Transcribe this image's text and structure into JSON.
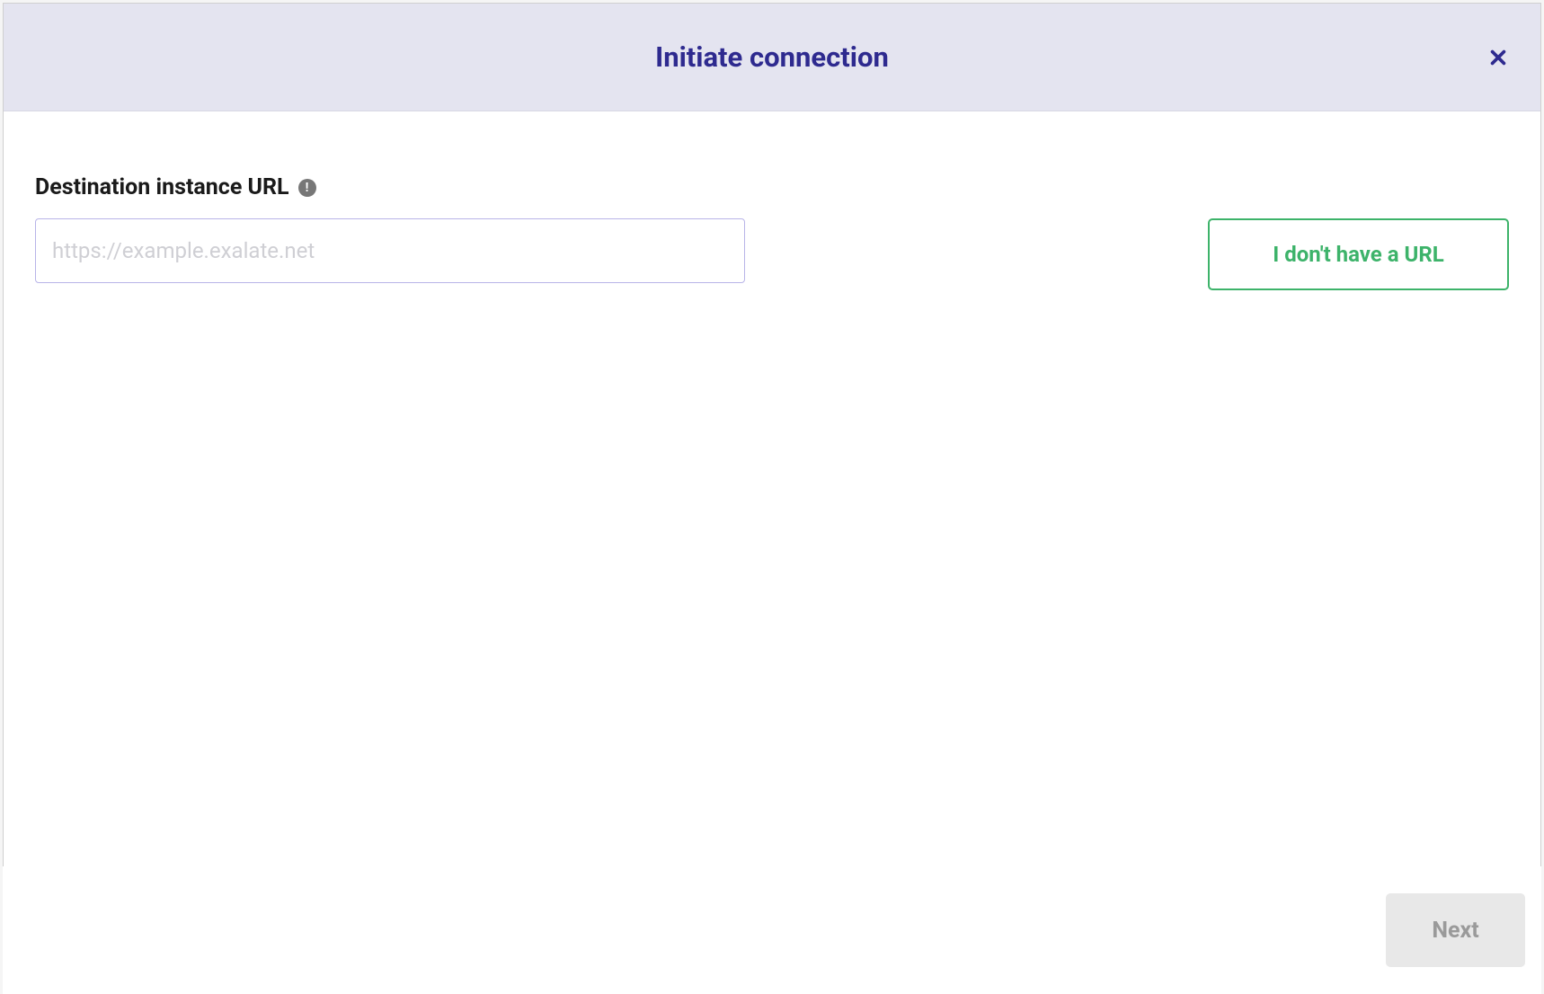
{
  "modal": {
    "title": "Initiate connection",
    "close_icon": "close-icon"
  },
  "form": {
    "url_label": "Destination instance URL",
    "url_placeholder": "https://example.exalate.net",
    "url_value": "",
    "info_icon": "info-icon",
    "no_url_button_label": "I don't have a URL"
  },
  "footer": {
    "next_button_label": "Next"
  }
}
